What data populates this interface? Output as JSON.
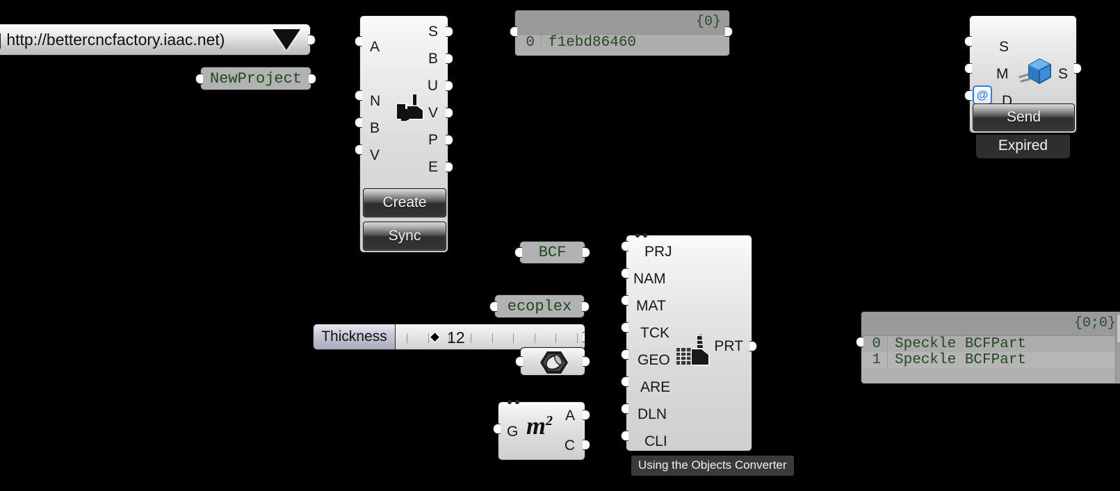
{
  "project_dropdown": {
    "value": "| http://bettercncfactory.iaac.net)",
    "icon": "chevron-down-icon"
  },
  "project_name_param": {
    "value": "NewProject"
  },
  "factory_component": {
    "icon": "factory-icon",
    "inputs": [
      "A",
      "N",
      "B",
      "V"
    ],
    "outputs": [
      "S",
      "B",
      "U",
      "V",
      "P",
      "E"
    ],
    "create_label": "Create",
    "sync_label": "Sync"
  },
  "id_panel": {
    "header": "{0}",
    "rows": [
      {
        "index": "0",
        "value": "f1ebd86460"
      }
    ]
  },
  "speckle_sender": {
    "icon": "speckle-cube-icon",
    "inputs": [
      "S",
      "M",
      "D"
    ],
    "outputs": [
      "S"
    ],
    "flatten_badge": "@",
    "send_label": "Send",
    "status": "Expired"
  },
  "bcf_param": {
    "value": "BCF"
  },
  "material_param": {
    "value": "ecoplex"
  },
  "thickness_slider": {
    "label": "Thickness",
    "value": "12",
    "tick_count": 9
  },
  "extrusion_component": {
    "icon": "hexagon-extrusion-icon"
  },
  "area_component": {
    "icon": "m2-area-icon",
    "inputs": [
      "G"
    ],
    "outputs": [
      "A",
      "C"
    ]
  },
  "bcfpart_component": {
    "icon": "factory-brick-icon",
    "inputs": [
      "PRJ",
      "NAM",
      "MAT",
      "TCK",
      "GEO",
      "ARE",
      "DLN",
      "CLI"
    ],
    "outputs": [
      "PRT"
    ],
    "tooltip": "Using the Objects Converter"
  },
  "result_panel": {
    "header": "{0;0}",
    "rows": [
      {
        "index": "0",
        "value": "Speckle BCFPart"
      },
      {
        "index": "1",
        "value": "Speckle BCFPart"
      }
    ]
  },
  "colors": {
    "canvas": "#000000",
    "panel_text": "#23491f",
    "accent_blue": "#2f7fe0"
  }
}
